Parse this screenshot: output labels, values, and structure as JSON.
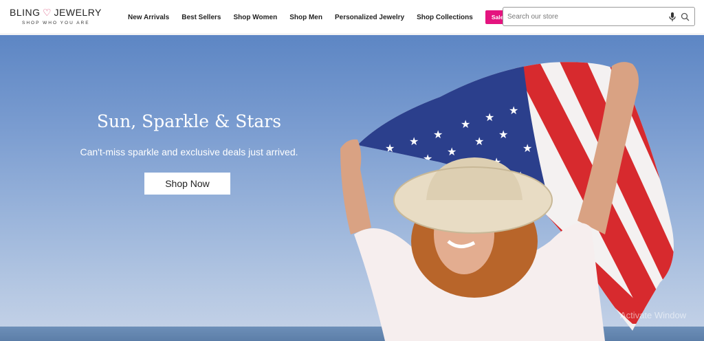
{
  "logo": {
    "name_left": "BLING",
    "name_right": "JEWELRY",
    "tagline": "SHOP WHO YOU ARE"
  },
  "nav": {
    "items": [
      {
        "label": "New Arrivals"
      },
      {
        "label": "Best Sellers"
      },
      {
        "label": "Shop Women"
      },
      {
        "label": "Shop Men"
      },
      {
        "label": "Personalized Jewelry"
      },
      {
        "label": "Shop Collections"
      }
    ],
    "sale_label": "Sale"
  },
  "search": {
    "placeholder": "Search our store",
    "value": ""
  },
  "hero": {
    "title": "Sun, Sparkle & Stars",
    "subtitle": "Can't-miss sparkle and exclusive deals just arrived.",
    "cta_label": "Shop Now"
  },
  "overlay": {
    "watermark": "Activate Window"
  },
  "colors": {
    "sale": "#e4147f",
    "brand_heart": "#d63c6b"
  },
  "icons": [
    "heart-logo-icon",
    "microphone-icon",
    "search-icon"
  ]
}
